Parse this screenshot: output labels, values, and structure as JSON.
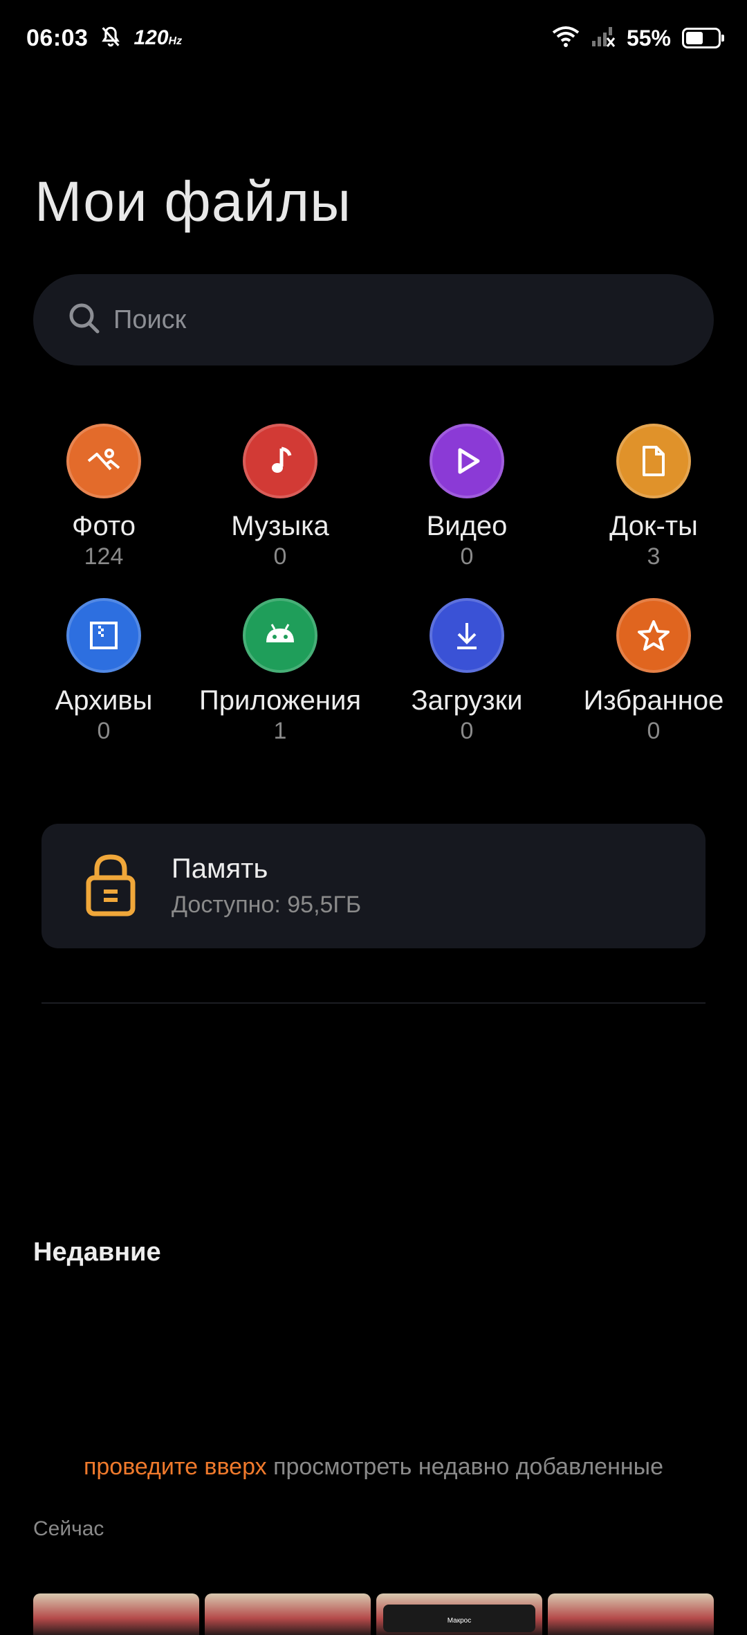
{
  "status_bar": {
    "time": "06:03",
    "refresh_rate": "120",
    "refresh_unit": "Hz",
    "battery_percent": "55%",
    "battery_level": 0.55
  },
  "title": "Мои файлы",
  "search": {
    "placeholder": "Поиск"
  },
  "categories": [
    {
      "label": "Фото",
      "count": "124",
      "color": "#e36b2b",
      "icon": "photo-icon"
    },
    {
      "label": "Музыка",
      "count": "0",
      "color": "#d23a35",
      "icon": "music-note-icon"
    },
    {
      "label": "Видео",
      "count": "0",
      "color": "#8b3ad6",
      "icon": "play-icon"
    },
    {
      "label": "Док-ты",
      "count": "3",
      "color": "#e0922a",
      "icon": "document-icon"
    },
    {
      "label": "Архивы",
      "count": "0",
      "color": "#2d6fe0",
      "icon": "archive-icon"
    },
    {
      "label": "Приложения",
      "count": "1",
      "color": "#1f9e5a",
      "icon": "android-icon"
    },
    {
      "label": "Загрузки",
      "count": "0",
      "color": "#3a52d6",
      "icon": "download-icon"
    },
    {
      "label": "Избранное",
      "count": "0",
      "color": "#e0651f",
      "icon": "star-icon"
    }
  ],
  "storage": {
    "title": "Память",
    "subtitle": "Доступно: 95,5ГБ",
    "icon": "storage-lock-icon",
    "color": "#f0a73a"
  },
  "recent": {
    "title": "Недавние",
    "hint_accent": "проведите вверх",
    "hint_rest": " просмотреть недавно добавленные",
    "time_label": "Сейчас",
    "thumb_caption": "Макрос"
  },
  "colors": {
    "accent": "#f07a2c",
    "card_bg": "#16181f"
  }
}
